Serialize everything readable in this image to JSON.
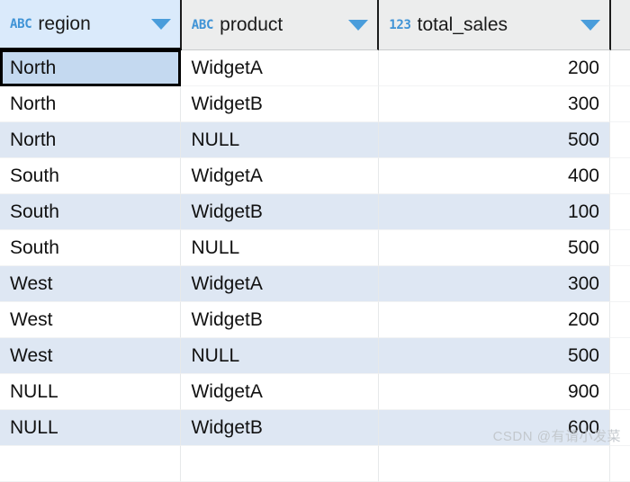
{
  "table": {
    "columns": [
      {
        "name": "region",
        "type_icon": "ABC",
        "type": "text",
        "align": "left",
        "sort_menu": "chevron-down-icon",
        "active": true
      },
      {
        "name": "product",
        "type_icon": "ABC",
        "type": "text",
        "align": "left",
        "sort_menu": "chevron-down-icon",
        "active": false
      },
      {
        "name": "total_sales",
        "type_icon": "123",
        "type": "number",
        "align": "right",
        "sort_menu": "chevron-down-icon",
        "active": false
      }
    ],
    "rows": [
      {
        "region": "North",
        "product": "WidgetA",
        "total_sales": "200"
      },
      {
        "region": "North",
        "product": "WidgetB",
        "total_sales": "300"
      },
      {
        "region": "North",
        "product": "NULL",
        "total_sales": "500"
      },
      {
        "region": "South",
        "product": "WidgetA",
        "total_sales": "400"
      },
      {
        "region": "South",
        "product": "WidgetB",
        "total_sales": "100"
      },
      {
        "region": "South",
        "product": "NULL",
        "total_sales": "500"
      },
      {
        "region": "West",
        "product": "WidgetA",
        "total_sales": "300"
      },
      {
        "region": "West",
        "product": "WidgetB",
        "total_sales": "200"
      },
      {
        "region": "West",
        "product": "NULL",
        "total_sales": "500"
      },
      {
        "region": "NULL",
        "product": "WidgetA",
        "total_sales": "900"
      },
      {
        "region": "NULL",
        "product": "WidgetB",
        "total_sales": "600"
      }
    ],
    "selected_cell": {
      "row": 0,
      "column": "region",
      "value": "North"
    }
  },
  "colors": {
    "header_active_bg": "#daeafb",
    "header_bg": "#eceded",
    "row_alt_bg": "#dee7f3",
    "row_bg": "#ffffff",
    "selected_bg": "#c4d9f0",
    "accent_blue": "#3f93d6",
    "caret_blue": "#4a9ddb",
    "text": "#111111",
    "watermark": "#c3c8cd"
  },
  "watermark": {
    "text": "CSDN @有请小发菜"
  }
}
